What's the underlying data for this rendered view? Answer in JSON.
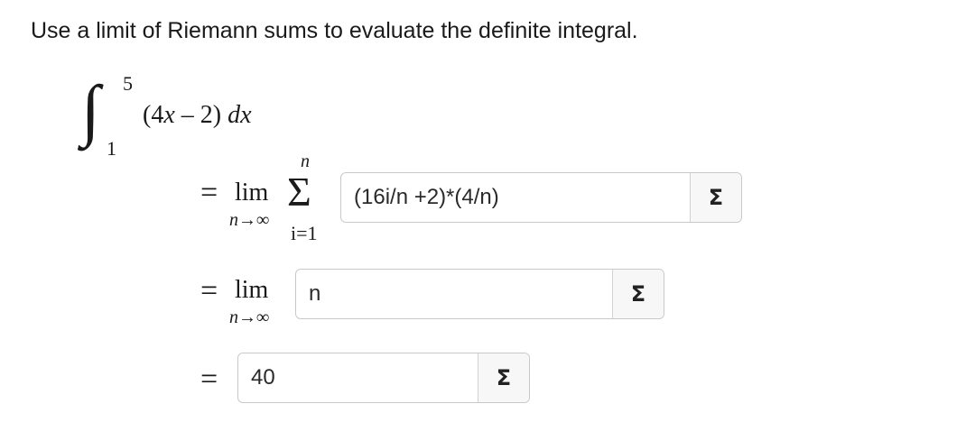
{
  "prompt": "Use a limit of Riemann sums to evaluate the definite integral.",
  "integral": {
    "upper": "5",
    "lower": "1",
    "open_paren": "(4",
    "var": "x",
    "rest": " – 2) ",
    "dx": "dx"
  },
  "step1": {
    "equals": "=",
    "lim": "lim",
    "lim_sub": "n→∞",
    "sigma": "Σ",
    "sigma_top": "n",
    "sigma_bottom": "i=1",
    "input_value": "(16i/n +2)*(4/n)",
    "button_label": "Σ"
  },
  "step2": {
    "equals": "=",
    "lim": "lim",
    "lim_sub": "n→∞",
    "input_value": "n",
    "button_label": "Σ"
  },
  "step3": {
    "equals": "=",
    "input_value": "40",
    "button_label": "Σ"
  }
}
